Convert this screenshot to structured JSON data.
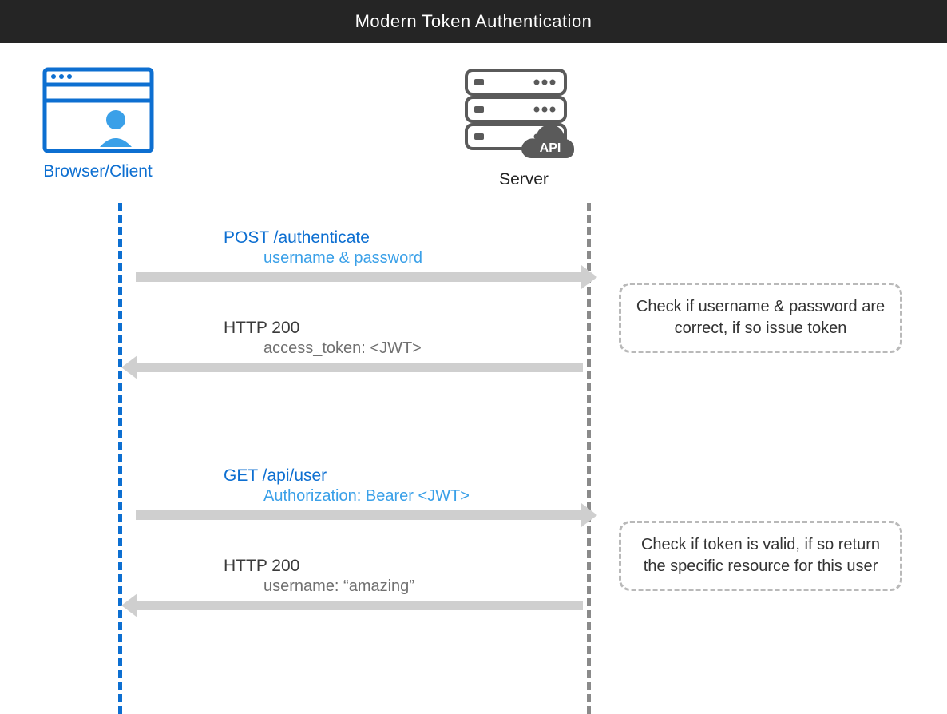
{
  "header": {
    "title": "Modern Token Authentication"
  },
  "actors": {
    "client": {
      "label": "Browser/Client"
    },
    "server": {
      "label": "Server",
      "api_badge": "API"
    }
  },
  "messages": {
    "m1": {
      "title": "POST /authenticate",
      "sub": "username & password"
    },
    "m2": {
      "title": "HTTP 200",
      "sub": "access_token: <JWT>"
    },
    "m3": {
      "title": "GET /api/user",
      "sub": "Authorization: Bearer <JWT>"
    },
    "m4": {
      "title": "HTTP 200",
      "sub": "username: “amazing”"
    }
  },
  "notes": {
    "n1": "Check if username & password are correct, if so issue token",
    "n2": "Check if token is valid, if so return the specific resource for this user"
  }
}
